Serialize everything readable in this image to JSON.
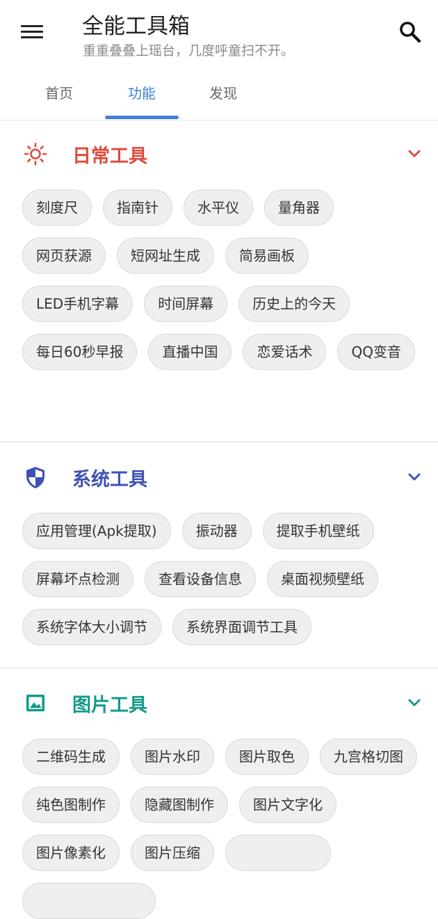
{
  "header": {
    "title": "全能工具箱",
    "subtitle": "重重叠叠上瑶台，几度呼童扫不开。"
  },
  "tabs": [
    {
      "label": "首页",
      "active": false
    },
    {
      "label": "功能",
      "active": true
    },
    {
      "label": "发现",
      "active": false
    }
  ],
  "colors": {
    "accent": "#3f7fd8",
    "daily": "#e04b3c",
    "system": "#3f51b5",
    "image": "#139a8a"
  },
  "sections": [
    {
      "title": "日常工具",
      "icon": "sun-icon",
      "items": [
        "刻度尺",
        "指南针",
        "水平仪",
        "量角器",
        "网页获源",
        "短网址生成",
        "简易画板",
        "LED手机字幕",
        "时间屏幕",
        "历史上的今天",
        "每日60秒早报",
        "直播中国",
        "恋爱话术",
        "QQ变音"
      ]
    },
    {
      "title": "系统工具",
      "icon": "shield-icon",
      "items": [
        "应用管理(Apk提取)",
        "振动器",
        "提取手机壁纸",
        "屏幕坏点检测",
        "查看设备信息",
        "桌面视频壁纸",
        "系统字体大小调节",
        "系统界面调节工具"
      ]
    },
    {
      "title": "图片工具",
      "icon": "image-icon",
      "items": [
        "二维码生成",
        "图片水印",
        "图片取色",
        "九宫格切图",
        "纯色图制作",
        "隐藏图制作",
        "图片文字化",
        "图片像素化",
        "图片压缩"
      ]
    }
  ]
}
